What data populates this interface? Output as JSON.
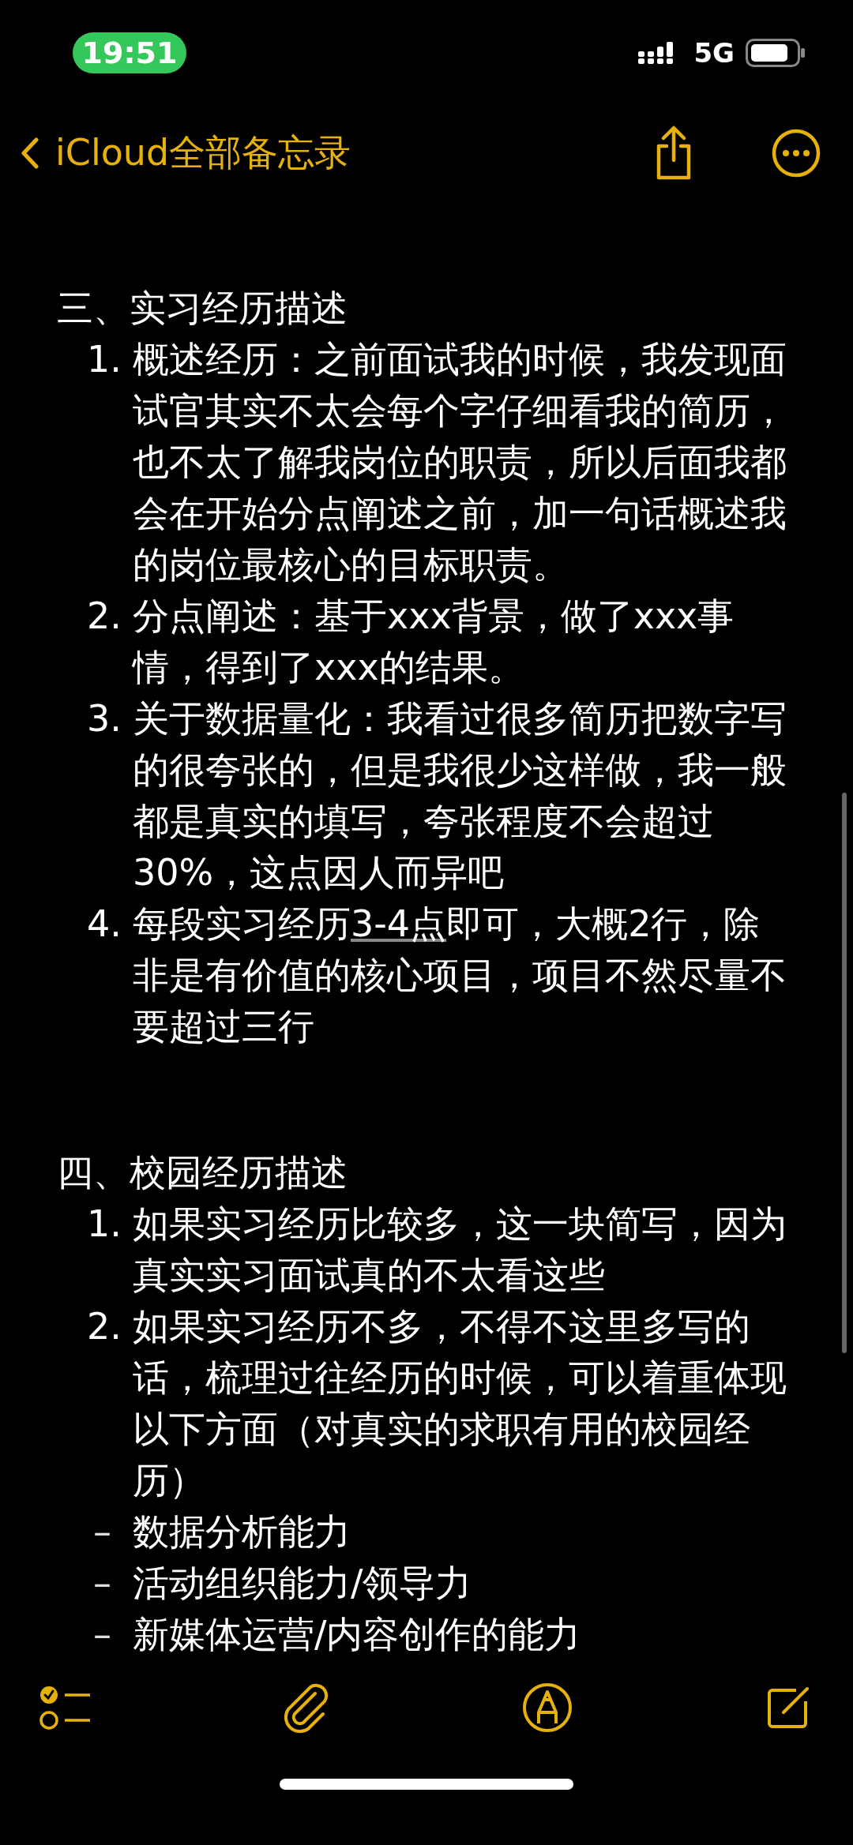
{
  "status_bar": {
    "time": "19:51",
    "network": "5G"
  },
  "nav": {
    "back_label": "iCloud全部备忘录"
  },
  "note": {
    "sections": [
      {
        "heading": "三、实习经历描述",
        "items": [
          {
            "kind": "numbered",
            "marker": "1.",
            "segments": [
              {
                "text": "概述经历：之前面试我的时候，我发现面试官其实不太会每个字仔细看我的简历，也不太了解我岗位的职责，所以后面我都会在开始分点阐述之前，加一句话概述我的岗位最核心的目标职责。",
                "underlined": false
              }
            ]
          },
          {
            "kind": "numbered",
            "marker": "2.",
            "segments": [
              {
                "text": "分点阐述：基于xxx背景，做了xxx事情，得到了xxx的结果。",
                "underlined": false
              }
            ]
          },
          {
            "kind": "numbered",
            "marker": "3.",
            "segments": [
              {
                "text": "关于数据量化：我看过很多简历把数字写的很夸张的，但是我很少这样做，我一般都是真实的填写，夸张程度不会超过 30%，这点因人而异吧",
                "underlined": false
              }
            ]
          },
          {
            "kind": "numbered",
            "marker": "4.",
            "segments": [
              {
                "text": "每段实习经历",
                "underlined": false
              },
              {
                "text": "3-4点",
                "underlined": true
              },
              {
                "text": "即可，大概2行，除非是有价值的核心项目，项目不然尽量不要超过三行",
                "underlined": false
              }
            ]
          }
        ]
      },
      {
        "heading": "四、校园经历描述",
        "items": [
          {
            "kind": "numbered",
            "marker": "1.",
            "segments": [
              {
                "text": "如果实习经历比较多，这一块简写，因为真实实习面试真的不太看这些",
                "underlined": false
              }
            ]
          },
          {
            "kind": "numbered",
            "marker": "2.",
            "segments": [
              {
                "text": "如果实习经历不多，不得不这里多写的话，梳理过往经历的时候，可以着重体现以下方面（对真实的求职有用的校园经历）",
                "underlined": false
              }
            ]
          },
          {
            "kind": "dash",
            "marker": "–",
            "segments": [
              {
                "text": "数据分析能力",
                "underlined": false
              }
            ]
          },
          {
            "kind": "dash",
            "marker": "–",
            "segments": [
              {
                "text": "活动组织能力/领导力",
                "underlined": false
              }
            ]
          },
          {
            "kind": "dash",
            "marker": "–",
            "segments": [
              {
                "text": "新媒体运营/内容创作的能力",
                "underlined": false
              }
            ]
          }
        ]
      }
    ]
  }
}
